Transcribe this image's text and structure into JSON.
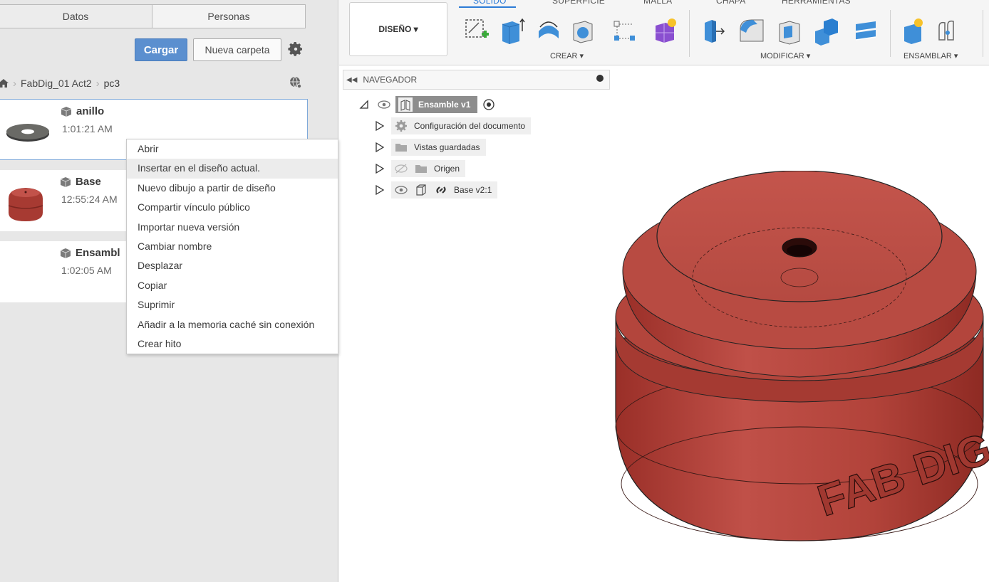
{
  "panel": {
    "tabs": [
      {
        "label": "Datos",
        "active": true
      },
      {
        "label": "Personas",
        "active": false
      }
    ],
    "buttons": {
      "upload_label": "Cargar",
      "new_folder_label": "Nueva carpeta"
    },
    "breadcrumb": {
      "project": "FabDig_01 Act2",
      "folder": "pc3"
    },
    "files": [
      {
        "name": "anillo",
        "time": "1:01:21 AM",
        "selected": true
      },
      {
        "name": "Base",
        "time": "12:55:24 AM",
        "selected": false
      },
      {
        "name": "Ensambl",
        "time": "1:02:05 AM",
        "selected": false
      }
    ]
  },
  "context_menu": {
    "items": [
      "Abrir",
      "Insertar en el diseño actual.",
      "Nuevo dibujo a partir de diseño",
      "Compartir vínculo público",
      "Importar nueva versión",
      "Cambiar nombre",
      "Desplazar",
      "Copiar",
      "Suprimir",
      "Añadir a la memoria caché sin conexión",
      "Crear hito"
    ],
    "hovered_index": 1
  },
  "toolbar": {
    "workspace_tabs": [
      "SÓLIDO",
      "SUPERFICIE",
      "MALLA",
      "CHAPA",
      "HERRAMIENTAS"
    ],
    "active_tab": "SÓLIDO",
    "design_button": "DISEÑO ▾",
    "groups": {
      "create": "CREAR ▾",
      "modify": "MODIFICAR ▾",
      "assemble": "ENSAMBLAR ▾"
    }
  },
  "browser": {
    "title": "NAVEGADOR",
    "root": "Ensamble v1",
    "nodes": [
      "Configuración del documento",
      "Vistas guardadas",
      "Origen",
      "Base v2:1"
    ]
  },
  "model": {
    "engraving": "FAB DIG",
    "color": "#b2433a"
  },
  "colors": {
    "accent": "#5b8fcf",
    "tab_active": "#2c7bd6"
  }
}
